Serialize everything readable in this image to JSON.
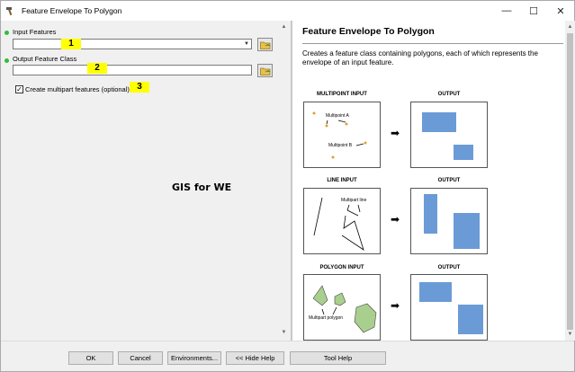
{
  "window": {
    "title": "Feature Envelope To Polygon",
    "controls": [
      "—",
      "☐",
      "✕"
    ]
  },
  "form": {
    "input_features": {
      "label": "Input Features",
      "value": "",
      "badge": "1"
    },
    "output_feature_class": {
      "label": "Output Feature Class",
      "value": "",
      "badge": "2"
    },
    "multipart": {
      "label": "Create multipart features (optional)",
      "checked": true,
      "check_glyph": "✓",
      "badge": "3"
    },
    "watermark": "GIS for WE"
  },
  "help": {
    "title": "Feature Envelope To Polygon",
    "description": "Creates a feature class containing polygons, each of which represents the envelope of an input feature.",
    "rows": [
      {
        "input_heading": "MULTIPOINT INPUT",
        "output_heading": "OUTPUT",
        "labels": [
          "Multipoint A",
          "Multipoint B"
        ]
      },
      {
        "input_heading": "LINE INPUT",
        "output_heading": "OUTPUT",
        "labels": [
          "Multipart line"
        ]
      },
      {
        "input_heading": "POLYGON INPUT",
        "output_heading": "OUTPUT",
        "labels": [
          "Multipart polygon"
        ]
      }
    ],
    "arrow_glyph": "➡"
  },
  "buttons": {
    "ok": "OK",
    "cancel": "Cancel",
    "environments": "Environments...",
    "hide_help": "<< Hide Help",
    "tool_help": "Tool Help"
  },
  "colors": {
    "required_dot": "#2fbe3a",
    "badge": "#ffff00",
    "envelope_fill": "#6b9bd6",
    "polygon_fill": "#a9cf8f"
  }
}
